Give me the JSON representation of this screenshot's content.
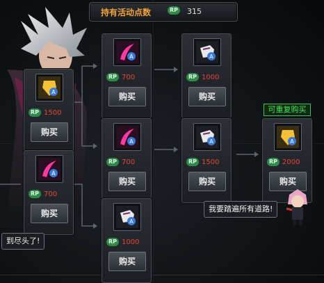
{
  "header": {
    "title": "持有活动点数",
    "rp_badge": "RP",
    "points": "315"
  },
  "cards": [
    {
      "id": "c1",
      "price": "1500",
      "buy": "购买",
      "icon": "gold-armor-icon",
      "accent": "#f5c13a"
    },
    {
      "id": "c2",
      "price": "700",
      "buy": "购买",
      "icon": "pink-blade-icon",
      "accent": "#ff3aa0"
    },
    {
      "id": "c3",
      "price": "700",
      "buy": "购买",
      "icon": "pink-blade-icon",
      "accent": "#ff3aa0"
    },
    {
      "id": "c4",
      "price": "700",
      "buy": "购买",
      "icon": "pink-blade-icon",
      "accent": "#ff3aa0"
    },
    {
      "id": "c5",
      "price": "1000",
      "buy": "购买",
      "icon": "white-gauntlet-icon",
      "accent": "#e8e8e8"
    },
    {
      "id": "c6",
      "price": "1000",
      "buy": "购买",
      "icon": "white-gauntlet-icon",
      "accent": "#e8e8e8"
    },
    {
      "id": "c7",
      "price": "1500",
      "buy": "购买",
      "icon": "white-gauntlet-icon",
      "accent": "#e8e8e8"
    },
    {
      "id": "c8",
      "price": "2000",
      "buy": "购买",
      "icon": "gold-armor-icon",
      "accent": "#f5c13a"
    }
  ],
  "repeat_tag": "可重复购买",
  "bubble_left": "到尽头了!",
  "bubble_right": "我要踏遍所有道路!",
  "rp_label": "RP",
  "colors": {
    "price": "#e6443a",
    "header_title": "#f1a240",
    "tag": "#4fe05f",
    "rp": "#2f8a4a"
  }
}
